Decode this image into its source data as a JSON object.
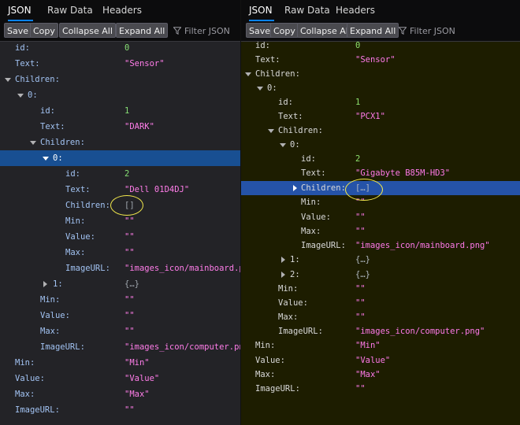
{
  "left": {
    "tabs": [
      "JSON",
      "Raw Data",
      "Headers"
    ],
    "toolbar": {
      "save": "Save",
      "copy": "Copy",
      "collapse_all": "Collapse All",
      "expand_all": "Expand All",
      "filter_placeholder": "Filter JSON"
    },
    "rows": [
      {
        "k": "id:",
        "v": "0"
      },
      {
        "k": "Text:",
        "v": "\"Sensor\""
      },
      {
        "k": "Children:",
        "v": ""
      },
      {
        "k": "0:",
        "v": ""
      },
      {
        "k": "id:",
        "v": "1"
      },
      {
        "k": "Text:",
        "v": "\"DARK\""
      },
      {
        "k": "Children:",
        "v": ""
      },
      {
        "k": "0:",
        "v": ""
      },
      {
        "k": "id:",
        "v": "2"
      },
      {
        "k": "Text:",
        "v": "\"Dell 01D4DJ\""
      },
      {
        "k": "Children:",
        "v": "[]"
      },
      {
        "k": "Min:",
        "v": "\"\""
      },
      {
        "k": "Value:",
        "v": "\"\""
      },
      {
        "k": "Max:",
        "v": "\"\""
      },
      {
        "k": "ImageURL:",
        "v": "\"images_icon/mainboard.png\""
      },
      {
        "k": "1:",
        "v": "{…}"
      },
      {
        "k": "Min:",
        "v": "\"\""
      },
      {
        "k": "Value:",
        "v": "\"\""
      },
      {
        "k": "Max:",
        "v": "\"\""
      },
      {
        "k": "ImageURL:",
        "v": "\"images_icon/computer.png\""
      },
      {
        "k": "Min:",
        "v": "\"Min\""
      },
      {
        "k": "Value:",
        "v": "\"Value\""
      },
      {
        "k": "Max:",
        "v": "\"Max\""
      },
      {
        "k": "ImageURL:",
        "v": "\"\""
      }
    ]
  },
  "right": {
    "tabs": [
      "JSON",
      "Raw Data",
      "Headers"
    ],
    "toolbar": {
      "save": "Save",
      "copy": "Copy",
      "collapse_all": "Collapse All",
      "expand_all": "Expand All",
      "filter_placeholder": "Filter JSON"
    },
    "rows": [
      {
        "k": "id:",
        "v": "0"
      },
      {
        "k": "Text:",
        "v": "\"Sensor\""
      },
      {
        "k": "Children:",
        "v": ""
      },
      {
        "k": "0:",
        "v": ""
      },
      {
        "k": "id:",
        "v": "1"
      },
      {
        "k": "Text:",
        "v": "\"PCX1\""
      },
      {
        "k": "Children:",
        "v": ""
      },
      {
        "k": "0:",
        "v": ""
      },
      {
        "k": "id:",
        "v": "2"
      },
      {
        "k": "Text:",
        "v": "\"Gigabyte B85M-HD3\""
      },
      {
        "k": "Children:",
        "v": "[…]"
      },
      {
        "k": "Min:",
        "v": "\"\""
      },
      {
        "k": "Value:",
        "v": "\"\""
      },
      {
        "k": "Max:",
        "v": "\"\""
      },
      {
        "k": "ImageURL:",
        "v": "\"images_icon/mainboard.png\""
      },
      {
        "k": "1:",
        "v": "{…}"
      },
      {
        "k": "2:",
        "v": "{…}"
      },
      {
        "k": "Min:",
        "v": "\"\""
      },
      {
        "k": "Value:",
        "v": "\"\""
      },
      {
        "k": "Max:",
        "v": "\"\""
      },
      {
        "k": "ImageURL:",
        "v": "\"images_icon/computer.png\""
      },
      {
        "k": "Min:",
        "v": "\"Min\""
      },
      {
        "k": "Value:",
        "v": "\"Value\""
      },
      {
        "k": "Max:",
        "v": "\"Max\""
      },
      {
        "k": "ImageURL:",
        "v": "\"\""
      }
    ]
  },
  "colors": {
    "left_background": "#232327",
    "right_background": "#1d1d00",
    "selection": "#184f92",
    "highlight_circle": "#f2e84c",
    "string": "#ff7de9",
    "number": "#86de74",
    "key": "#a2c3f3"
  }
}
